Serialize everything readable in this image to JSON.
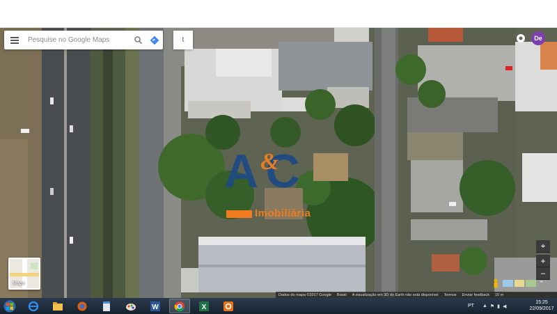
{
  "search": {
    "placeholder": "Pesquise no Google Maps"
  },
  "extra_tab": "t",
  "account": {
    "avatar_initials": "De",
    "color": "#7b3fb0"
  },
  "logo": {
    "text": "A&C",
    "subtitle": "Imobiliária",
    "primary_color": "#1e4a84",
    "accent_color": "#f07b1f"
  },
  "layer_toggle": {
    "label": "Mapa"
  },
  "map_controls": {
    "zoom_in": "+",
    "zoom_out": "−",
    "compass": "⌖"
  },
  "attribution": {
    "data": "Dados do mapa ©2017 Google",
    "country": "Brasil",
    "note": "A visualização em 3D do Earth não está disponível",
    "terms": "Termos",
    "feedback": "Enviar feedback",
    "scale": "10 m"
  },
  "taskbar": {
    "apps": [
      "internet-explorer",
      "file-explorer",
      "firefox",
      "notepad",
      "paint",
      "word",
      "chrome",
      "excel",
      "app-orange"
    ],
    "active_app": "chrome",
    "language": "PT",
    "time": "15:25",
    "date": "22/09/2017"
  }
}
